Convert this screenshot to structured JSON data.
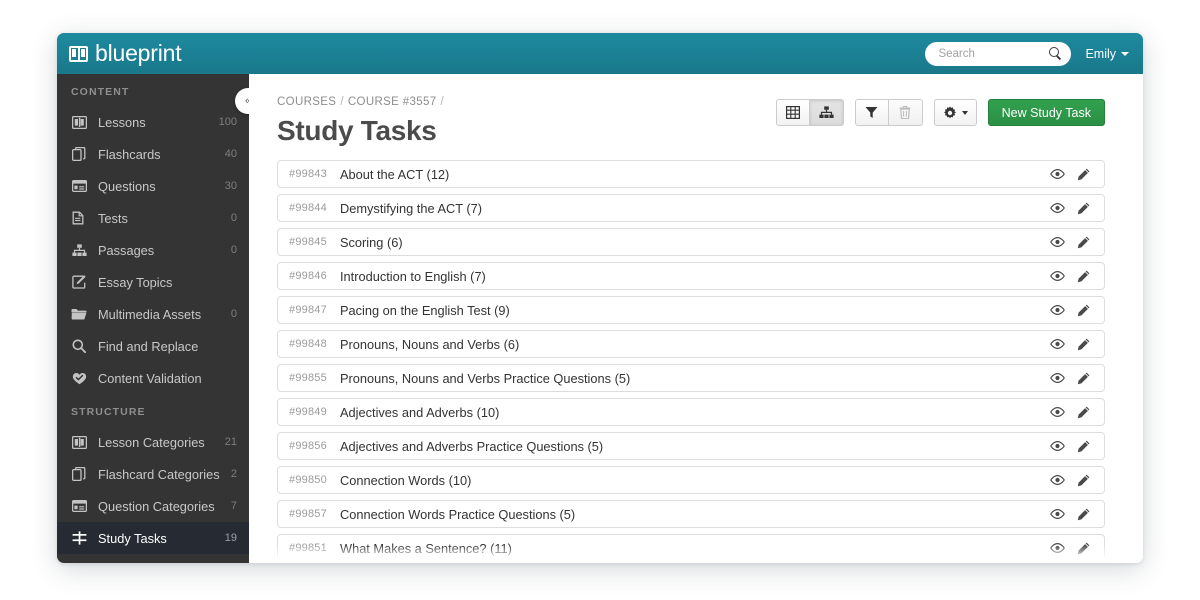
{
  "app": {
    "brand": "blueprint",
    "logo_icon": "book-logo-icon"
  },
  "header": {
    "search": {
      "placeholder": "Search",
      "value": "",
      "icon": "search-icon"
    },
    "user": {
      "name": "Emily",
      "caret_icon": "caret-down-icon"
    }
  },
  "sidebar": {
    "collapse_button": {
      "icon": "double-chevron-left-icon",
      "glyph": "«"
    },
    "sections": [
      {
        "label": "CONTENT",
        "items": [
          {
            "label": "Lessons",
            "count": "100",
            "icon": "lessons-icon",
            "active": false
          },
          {
            "label": "Flashcards",
            "count": "40",
            "icon": "flashcards-icon",
            "active": false
          },
          {
            "label": "Questions",
            "count": "30",
            "icon": "questions-icon",
            "active": false
          },
          {
            "label": "Tests",
            "count": "0",
            "icon": "tests-icon",
            "active": false
          },
          {
            "label": "Passages",
            "count": "0",
            "icon": "passages-icon",
            "active": false
          },
          {
            "label": "Essay Topics",
            "count": "",
            "icon": "essay-topics-icon",
            "active": false
          },
          {
            "label": "Multimedia Assets",
            "count": "0",
            "icon": "folder-icon",
            "active": false
          },
          {
            "label": "Find and Replace",
            "count": "",
            "icon": "search-icon",
            "active": false
          },
          {
            "label": "Content Validation",
            "count": "",
            "icon": "heart-check-icon",
            "active": false
          }
        ]
      },
      {
        "label": "STRUCTURE",
        "items": [
          {
            "label": "Lesson Categories",
            "count": "21",
            "icon": "lessons-icon",
            "active": false
          },
          {
            "label": "Flashcard Categories",
            "count": "2",
            "icon": "flashcards-icon",
            "active": false
          },
          {
            "label": "Question Categories",
            "count": "7",
            "icon": "questions-icon",
            "active": false
          },
          {
            "label": "Study Tasks",
            "count": "19",
            "icon": "study-tasks-icon",
            "active": true
          }
        ]
      }
    ]
  },
  "main": {
    "breadcrumb": [
      {
        "label": "COURSES",
        "sep": "/"
      },
      {
        "label": "COURSE #3557",
        "sep": "/"
      }
    ],
    "page_title": "Study Tasks",
    "toolbar": {
      "view_table": {
        "label": "",
        "icon": "table-view-icon",
        "active": false
      },
      "view_tree": {
        "label": "",
        "icon": "tree-view-icon",
        "active": true
      },
      "filter": {
        "label": "",
        "icon": "filter-icon",
        "disabled": false
      },
      "delete": {
        "label": "",
        "icon": "trash-icon",
        "disabled": true
      },
      "settings": {
        "label": "",
        "icon": "gear-icon",
        "caret": "caret-down-icon"
      },
      "new_task": {
        "label": "New Study Task",
        "color": "#2b8f45"
      }
    },
    "row_actions": {
      "preview": {
        "icon": "eye-icon"
      },
      "edit": {
        "icon": "pencil-icon"
      }
    },
    "tasks": [
      {
        "id": "#99843",
        "title": "About the ACT (12)"
      },
      {
        "id": "#99844",
        "title": "Demystifying the ACT (7)"
      },
      {
        "id": "#99845",
        "title": "Scoring (6)"
      },
      {
        "id": "#99846",
        "title": "Introduction to English (7)"
      },
      {
        "id": "#99847",
        "title": "Pacing on the English Test (9)"
      },
      {
        "id": "#99848",
        "title": "Pronouns, Nouns and Verbs (6)"
      },
      {
        "id": "#99855",
        "title": "Pronouns, Nouns and Verbs Practice Questions (5)"
      },
      {
        "id": "#99849",
        "title": "Adjectives and Adverbs (10)"
      },
      {
        "id": "#99856",
        "title": "Adjectives and Adverbs Practice Questions (5)"
      },
      {
        "id": "#99850",
        "title": "Connection Words (10)"
      },
      {
        "id": "#99857",
        "title": "Connection Words Practice Questions (5)"
      },
      {
        "id": "#99851",
        "title": "What Makes a Sentence? (11)"
      },
      {
        "id": "",
        "title": ""
      }
    ]
  },
  "colors": {
    "brand_teal": "#1b7f93",
    "sidebar_bg": "#343434",
    "sidebar_active_bg": "#262b33",
    "primary_green": "#2b8f45",
    "page_bg": "#ffffff",
    "row_border": "#dddddd"
  }
}
